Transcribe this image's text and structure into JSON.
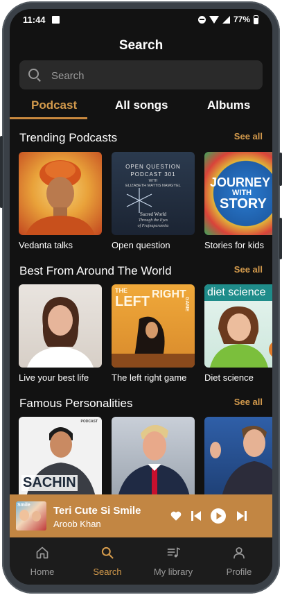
{
  "status_bar": {
    "time": "11:44",
    "battery": "77%"
  },
  "header": {
    "title": "Search"
  },
  "search": {
    "placeholder": "Search"
  },
  "tabs": [
    {
      "label": "Podcast",
      "active": true
    },
    {
      "label": "All songs",
      "active": false
    },
    {
      "label": "Albums",
      "active": false
    }
  ],
  "sections": [
    {
      "title": "Trending Podcasts",
      "see_all": "See all",
      "items": [
        {
          "label": "Vedanta talks"
        },
        {
          "label": "Open question",
          "cover_text": [
            "OPEN QUESTION",
            "PODCAST 301",
            "WITH",
            "ELIZABETH MATTIS NAMGYEL",
            "Sacred World",
            "Through the Eyes",
            "of Prajnaparamita"
          ]
        },
        {
          "label": "Stories for kids",
          "cover_text": [
            "JOURNEY",
            "WITH",
            "STORY"
          ]
        }
      ]
    },
    {
      "title": "Best From Around The World",
      "see_all": "See all",
      "items": [
        {
          "label": "Live your best life"
        },
        {
          "label": "The left right game",
          "cover_text": [
            "THE",
            "LEFT",
            "RIGHT",
            "GAME"
          ]
        },
        {
          "label": "Diet science",
          "cover_text": [
            "diet science"
          ]
        }
      ]
    },
    {
      "title": "Famous Personalities",
      "see_all": "See all",
      "items": [
        {
          "label": "",
          "cover_text": [
            "SACHIN",
            "PODCAST"
          ]
        },
        {
          "label": ""
        },
        {
          "label": ""
        }
      ]
    }
  ],
  "player": {
    "song": "Teri Cute Si Smile",
    "artist": "Aroob Khan",
    "art_text": "Smile"
  },
  "bottom_nav": [
    {
      "label": "Home",
      "icon": "home-icon",
      "active": false
    },
    {
      "label": "Search",
      "icon": "search-icon",
      "active": true
    },
    {
      "label": "My library",
      "icon": "library-icon",
      "active": false
    },
    {
      "label": "Profile",
      "icon": "profile-icon",
      "active": false
    }
  ],
  "colors": {
    "accent": "#d39a4c",
    "player_bg": "#c28643",
    "background": "#121212"
  }
}
